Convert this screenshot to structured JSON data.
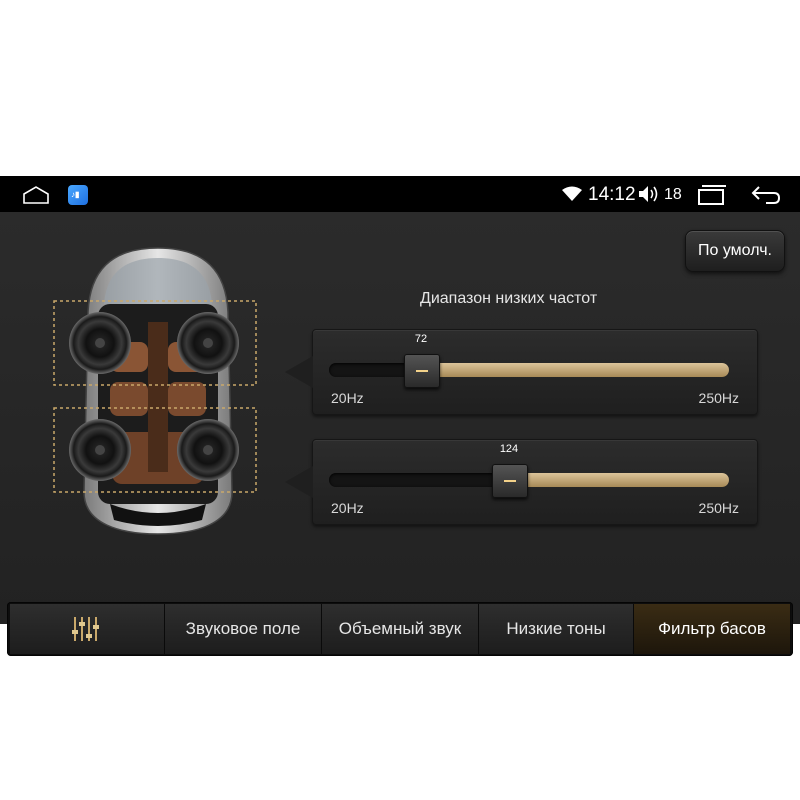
{
  "status_bar": {
    "time": "14:12",
    "volume": "18",
    "icons": [
      "home-icon",
      "app-icon",
      "wifi-icon",
      "volume-icon",
      "recent-apps-icon",
      "back-icon"
    ]
  },
  "header": {
    "default_button": "По умолч."
  },
  "section_title": "Диапазон низких частот",
  "sliders": [
    {
      "value": "72",
      "fraction": 0.23,
      "min_label": "20Hz",
      "max_label": "250Hz"
    },
    {
      "value": "124",
      "fraction": 0.45,
      "min_label": "20Hz",
      "max_label": "250Hz"
    }
  ],
  "tabs": [
    {
      "label": "",
      "icon": "equalizer-icon"
    },
    {
      "label": "Звуковое поле"
    },
    {
      "label": "Объемный звук"
    },
    {
      "label": "Низкие тоны"
    },
    {
      "label": "Фильтр басов",
      "active": true
    }
  ],
  "colors": {
    "accent": "#c9a86a",
    "background": "#262626",
    "statusbar": "#000000"
  }
}
